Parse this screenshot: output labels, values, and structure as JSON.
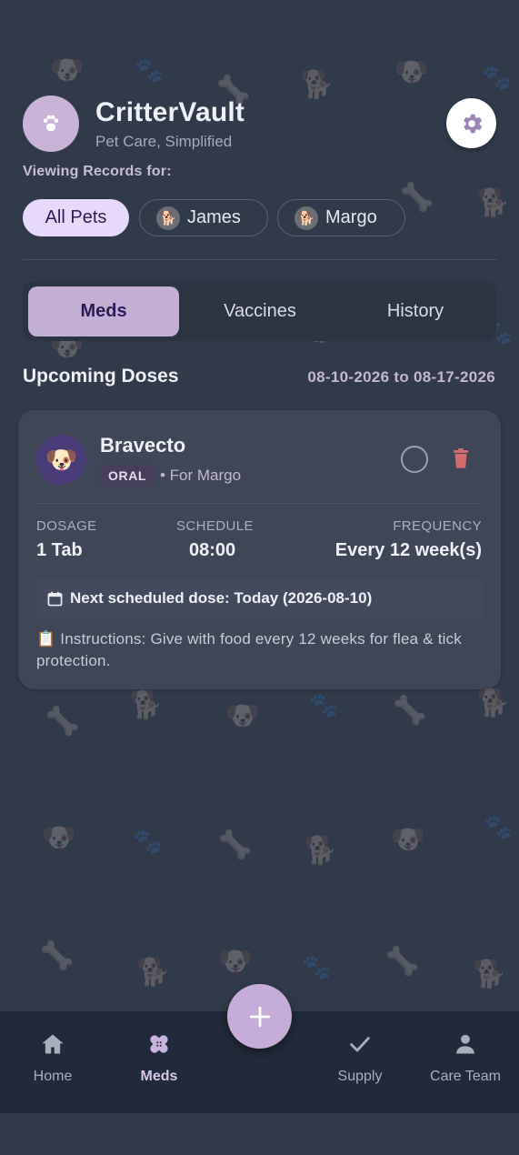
{
  "app": {
    "title": "CritterVault",
    "subtitle": "Pet Care, Simplified",
    "logo_icon": "paw-icon",
    "settings_icon": "gear-icon"
  },
  "viewing": {
    "label": "Viewing Records for:",
    "chips": [
      {
        "label": "All Pets",
        "active": true
      },
      {
        "label": "James",
        "active": false
      },
      {
        "label": "Margo",
        "active": false
      }
    ]
  },
  "tabs": [
    {
      "label": "Meds",
      "active": true
    },
    {
      "label": "Vaccines",
      "active": false
    },
    {
      "label": "History",
      "active": false
    }
  ],
  "section": {
    "title": "Upcoming Doses",
    "date_range": "08-10-2026 to 08-17-2026"
  },
  "medication": {
    "name": "Bravecto",
    "route": "ORAL",
    "for_pet": "• For Margo",
    "stats": {
      "dosage_label": "DOSAGE",
      "dosage_value": "1 Tab",
      "schedule_label": "SCHEDULE",
      "schedule_value": "08:00",
      "frequency_label": "FREQUENCY",
      "frequency_value": "Every 12 week(s)"
    },
    "next_dose": "Next scheduled dose: Today (2026-08-10)",
    "instructions": "📋 Instructions: Give with food every 12 weeks for flea & tick protection."
  },
  "nav": {
    "items": [
      {
        "label": "Home",
        "icon": "home-icon",
        "active": false
      },
      {
        "label": "Meds",
        "icon": "bandage-icon",
        "active": true
      },
      {
        "label": "Supply",
        "icon": "check-icon",
        "active": false
      },
      {
        "label": "Care Team",
        "icon": "person-icon",
        "active": false
      }
    ],
    "fab_icon": "plus-icon"
  },
  "colors": {
    "background": "#313a4b",
    "accent": "#c3b0d4",
    "card": "#3e4658",
    "nav": "#212a3a",
    "delete": "#d26b6b"
  }
}
